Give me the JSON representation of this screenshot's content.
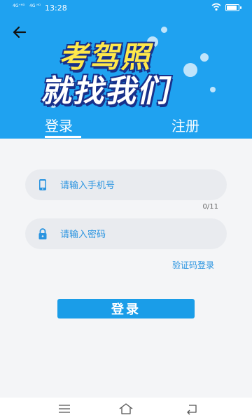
{
  "status_bar": {
    "signal_label_1": "4G⁺ᴴᴰ",
    "signal_label_2": "4G ᴴᴰ",
    "time": "13:28"
  },
  "header": {
    "banner_line1": "考驾照",
    "banner_line2": "就找我们",
    "tabs": [
      {
        "label": "登录",
        "active": true
      },
      {
        "label": "注册",
        "active": false
      }
    ]
  },
  "form": {
    "phone_placeholder": "请输入手机号",
    "phone_value": "",
    "phone_counter": "0/11",
    "password_placeholder": "请输入密码",
    "password_value": "",
    "code_login_link": "验证码登录",
    "login_button": "登录"
  },
  "colors": {
    "header_blue": "#1fa2f0",
    "accent_blue": "#2a94e0",
    "banner_yellow": "#ffe84a",
    "banner_outline": "#18308a"
  },
  "icons": {
    "back": "arrow-left-icon",
    "phone": "phone-icon",
    "lock": "lock-icon",
    "nav_menu": "menu-icon",
    "nav_home": "home-icon",
    "nav_back": "return-icon"
  }
}
